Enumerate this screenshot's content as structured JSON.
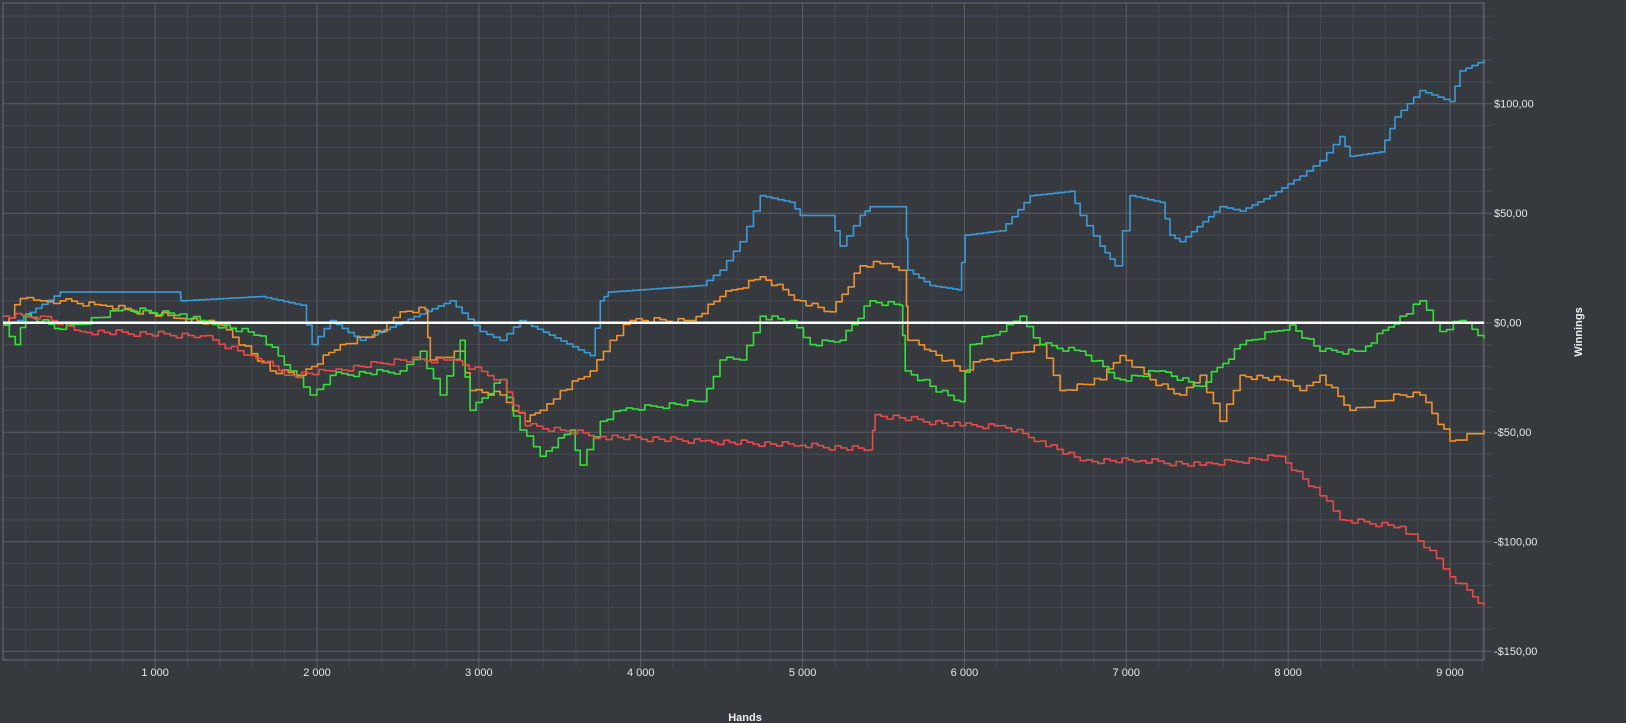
{
  "chart_data": {
    "type": "line",
    "title": "",
    "xlabel": "Hands",
    "ylabel": "Winnings",
    "xlim": [
      60,
      9210
    ],
    "ylim": [
      -154,
      146
    ],
    "grid": true,
    "legend": "none",
    "x_ticks": [
      {
        "value": 1000,
        "label": "1 000"
      },
      {
        "value": 2000,
        "label": "2 000"
      },
      {
        "value": 3000,
        "label": "3 000"
      },
      {
        "value": 4000,
        "label": "4 000"
      },
      {
        "value": 5000,
        "label": "5 000"
      },
      {
        "value": 6000,
        "label": "6 000"
      },
      {
        "value": 7000,
        "label": "7 000"
      },
      {
        "value": 8000,
        "label": "8 000"
      },
      {
        "value": 9000,
        "label": "9 000"
      }
    ],
    "y_ticks": [
      {
        "value": 100,
        "label": "$100,00"
      },
      {
        "value": 50,
        "label": "$50,00"
      },
      {
        "value": 0,
        "label": "$0,00"
      },
      {
        "value": -50,
        "label": "-$50,00"
      },
      {
        "value": -100,
        "label": "-$100,00"
      },
      {
        "value": -150,
        "label": "-$150,00"
      }
    ],
    "colors": {
      "background": "#363a3f",
      "zero_line": "#ffffff",
      "grid_major": "#5a5f66",
      "grid_minor": "#454a50"
    },
    "series": [
      {
        "name": "blue",
        "color": "#3a9ad9",
        "points": [
          [
            62,
            -1
          ],
          [
            150,
            1
          ],
          [
            414,
            14
          ],
          [
            1155,
            14
          ],
          [
            1160,
            10
          ],
          [
            1649,
            12
          ],
          [
            1900,
            8
          ],
          [
            1970,
            -10
          ],
          [
            2082,
            1
          ],
          [
            2267,
            -8
          ],
          [
            2823,
            10
          ],
          [
            3008,
            -4
          ],
          [
            3132,
            -8
          ],
          [
            3255,
            1
          ],
          [
            3688,
            -15
          ],
          [
            3750,
            10
          ],
          [
            3800,
            14
          ],
          [
            4367,
            17
          ],
          [
            4490,
            24
          ],
          [
            4614,
            37
          ],
          [
            4738,
            58
          ],
          [
            4923,
            55
          ],
          [
            4985,
            49
          ],
          [
            5170,
            49
          ],
          [
            5232,
            35
          ],
          [
            5356,
            49
          ],
          [
            5417,
            53
          ],
          [
            5634,
            53
          ],
          [
            5650,
            24
          ],
          [
            5788,
            17
          ],
          [
            5961,
            15
          ],
          [
            6004,
            40
          ],
          [
            6220,
            42
          ],
          [
            6406,
            58
          ],
          [
            6653,
            60
          ],
          [
            6715,
            49
          ],
          [
            6838,
            35
          ],
          [
            6931,
            26
          ],
          [
            7023,
            58
          ],
          [
            7209,
            55
          ],
          [
            7270,
            40
          ],
          [
            7332,
            37
          ],
          [
            7579,
            53
          ],
          [
            7703,
            51
          ],
          [
            7888,
            58
          ],
          [
            8073,
            67
          ],
          [
            8197,
            74
          ],
          [
            8320,
            85
          ],
          [
            8382,
            76
          ],
          [
            8567,
            78
          ],
          [
            8660,
            94
          ],
          [
            8814,
            106
          ],
          [
            9000,
            101
          ],
          [
            9062,
            115
          ],
          [
            9210,
            120
          ]
        ]
      },
      {
        "name": "orange",
        "color": "#f0922e",
        "points": [
          [
            62,
            -1
          ],
          [
            167,
            11
          ],
          [
            290,
            10
          ],
          [
            414,
            10
          ],
          [
            661,
            8
          ],
          [
            1155,
            2
          ],
          [
            1402,
            -1
          ],
          [
            1711,
            -22
          ],
          [
            1897,
            -24
          ],
          [
            2144,
            -10
          ],
          [
            2391,
            -4
          ],
          [
            2514,
            5
          ],
          [
            2669,
            6
          ],
          [
            2700,
            -17
          ],
          [
            2885,
            -13
          ],
          [
            2946,
            -31
          ],
          [
            3132,
            -33
          ],
          [
            3286,
            -45
          ],
          [
            3379,
            -40
          ],
          [
            3503,
            -31
          ],
          [
            3688,
            -22
          ],
          [
            3811,
            -8
          ],
          [
            3935,
            1
          ],
          [
            4305,
            1
          ],
          [
            4490,
            12
          ],
          [
            4738,
            21
          ],
          [
            4985,
            10
          ],
          [
            5170,
            5
          ],
          [
            5356,
            26
          ],
          [
            5479,
            27
          ],
          [
            5634,
            24
          ],
          [
            5650,
            -8
          ],
          [
            5788,
            -13
          ],
          [
            5973,
            -22
          ],
          [
            6097,
            -17
          ],
          [
            6220,
            -17
          ],
          [
            6467,
            -10
          ],
          [
            6591,
            -31
          ],
          [
            6838,
            -26
          ],
          [
            6962,
            -15
          ],
          [
            7147,
            -26
          ],
          [
            7332,
            -33
          ],
          [
            7456,
            -24
          ],
          [
            7579,
            -45
          ],
          [
            7703,
            -24
          ],
          [
            7950,
            -26
          ],
          [
            8073,
            -31
          ],
          [
            8197,
            -24
          ],
          [
            8382,
            -40
          ],
          [
            8691,
            -33
          ],
          [
            8814,
            -33
          ],
          [
            9000,
            -54
          ],
          [
            9210,
            -49
          ]
        ]
      },
      {
        "name": "green",
        "color": "#35e03a",
        "points": [
          [
            62,
            -1
          ],
          [
            136,
            -10
          ],
          [
            200,
            4
          ],
          [
            414,
            -3
          ],
          [
            800,
            6
          ],
          [
            1155,
            4
          ],
          [
            1279,
            1
          ],
          [
            1649,
            -6
          ],
          [
            1835,
            -22
          ],
          [
            1958,
            -33
          ],
          [
            2082,
            -24
          ],
          [
            2514,
            -22
          ],
          [
            2638,
            -13
          ],
          [
            2761,
            -33
          ],
          [
            2885,
            -8
          ],
          [
            2946,
            -40
          ],
          [
            3132,
            -26
          ],
          [
            3255,
            -49
          ],
          [
            3379,
            -61
          ],
          [
            3565,
            -49
          ],
          [
            3626,
            -65
          ],
          [
            3750,
            -45
          ],
          [
            3873,
            -40
          ],
          [
            4367,
            -36
          ],
          [
            4490,
            -17
          ],
          [
            4614,
            -17
          ],
          [
            4738,
            3
          ],
          [
            4923,
            1
          ],
          [
            5047,
            -10
          ],
          [
            5232,
            -8
          ],
          [
            5417,
            10
          ],
          [
            5603,
            8
          ],
          [
            5634,
            -22
          ],
          [
            5788,
            -29
          ],
          [
            5973,
            -36
          ],
          [
            6035,
            -10
          ],
          [
            6220,
            -4
          ],
          [
            6344,
            3
          ],
          [
            6467,
            -10
          ],
          [
            6715,
            -13
          ],
          [
            6962,
            -26
          ],
          [
            7209,
            -22
          ],
          [
            7456,
            -29
          ],
          [
            7703,
            -10
          ],
          [
            8011,
            -1
          ],
          [
            8197,
            -13
          ],
          [
            8444,
            -13
          ],
          [
            8691,
            3
          ],
          [
            8814,
            10
          ],
          [
            8938,
            -4
          ],
          [
            9062,
            1
          ],
          [
            9210,
            -7
          ]
        ]
      },
      {
        "name": "red",
        "color": "#e84a4a",
        "points": [
          [
            62,
            3
          ],
          [
            290,
            3
          ],
          [
            537,
            -4
          ],
          [
            1279,
            -6
          ],
          [
            1587,
            -15
          ],
          [
            1835,
            -24
          ],
          [
            2082,
            -22
          ],
          [
            2514,
            -17
          ],
          [
            2823,
            -17
          ],
          [
            3132,
            -26
          ],
          [
            3286,
            -47
          ],
          [
            3503,
            -49
          ],
          [
            3750,
            -52
          ],
          [
            4367,
            -54
          ],
          [
            4985,
            -56
          ],
          [
            5417,
            -58
          ],
          [
            5448,
            -42
          ],
          [
            5973,
            -47
          ],
          [
            6220,
            -47
          ],
          [
            6467,
            -54
          ],
          [
            6715,
            -63
          ],
          [
            7085,
            -63
          ],
          [
            7456,
            -65
          ],
          [
            7950,
            -61
          ],
          [
            8197,
            -79
          ],
          [
            8320,
            -90
          ],
          [
            8691,
            -93
          ],
          [
            8876,
            -104
          ],
          [
            9000,
            -116
          ],
          [
            9210,
            -129
          ]
        ]
      }
    ]
  }
}
